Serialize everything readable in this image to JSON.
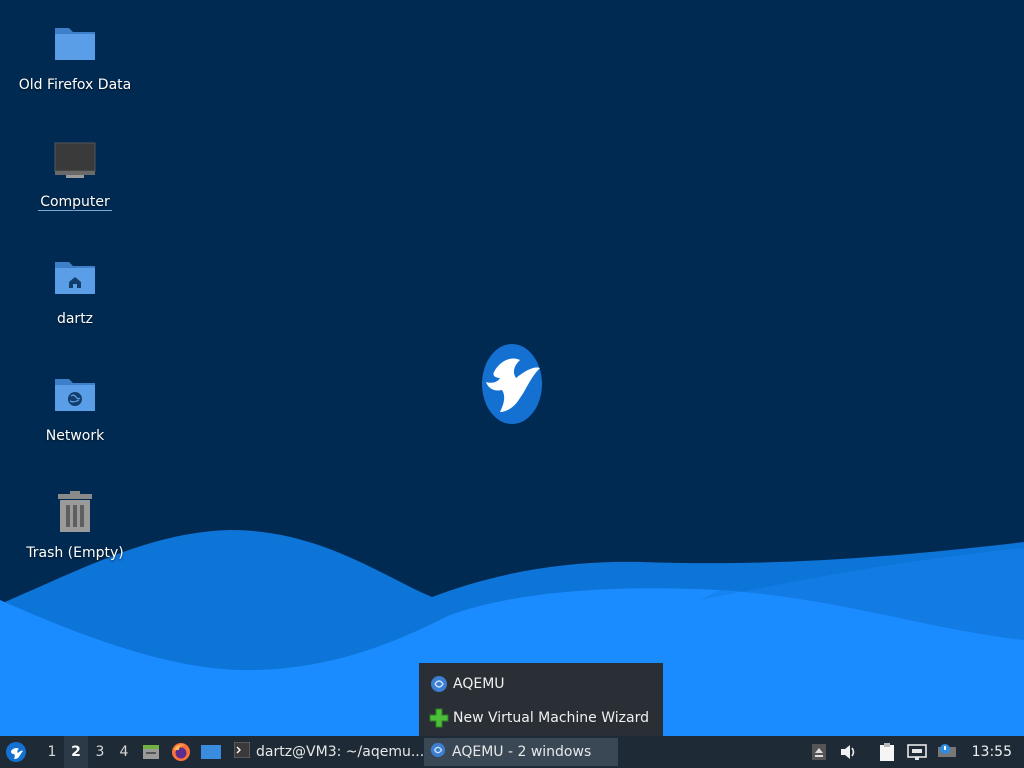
{
  "desktop": {
    "icons": [
      {
        "label": "Old Firefox Data",
        "icon": "folder-icon"
      },
      {
        "label": "Computer",
        "icon": "computer-icon"
      },
      {
        "label": "dartz",
        "icon": "home-folder-icon"
      },
      {
        "label": "Network",
        "icon": "network-folder-icon"
      },
      {
        "label": "Trash (Empty)",
        "icon": "trash-icon"
      }
    ]
  },
  "group_menu": {
    "items": [
      {
        "label": "AQEMU",
        "icon": "aqemu-icon"
      },
      {
        "label": "New Virtual Machine Wizard",
        "icon": "green-plus-icon"
      }
    ]
  },
  "taskbar": {
    "workspaces": [
      "1",
      "2",
      "3",
      "4"
    ],
    "active_workspace": "2",
    "tasks": [
      {
        "label": "dartz@VM3: ~/aqemu...",
        "icon": "terminal-icon"
      },
      {
        "label": "AQEMU - 2 windows",
        "icon": "aqemu-icon"
      }
    ],
    "clock": "13:55"
  },
  "colors": {
    "background": "#012a52",
    "wave_light": "#1a8cff",
    "taskbar": "#1e2b37",
    "folder_blue": "#4a90d9"
  }
}
